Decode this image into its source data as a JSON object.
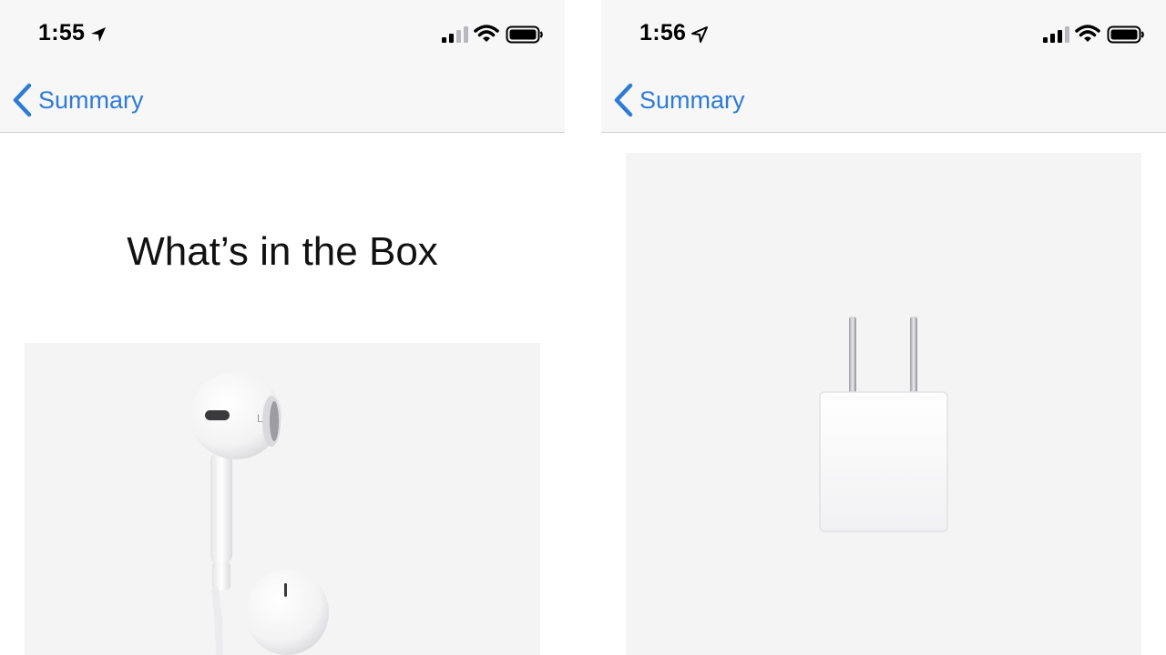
{
  "screens": [
    {
      "status_time": "1:55",
      "nav": {
        "back_label": "Summary"
      },
      "title": "What’s in the Box",
      "image": {
        "subject": "earpods",
        "earbud_marking": "L"
      }
    },
    {
      "status_time": "1:56",
      "nav": {
        "back_label": "Summary"
      },
      "image": {
        "subject": "usb-power-adapter"
      }
    }
  ],
  "colors": {
    "accent": "#2e7bd6",
    "nav_background": "#f7f7f7",
    "card_background": "#f4f4f4"
  }
}
